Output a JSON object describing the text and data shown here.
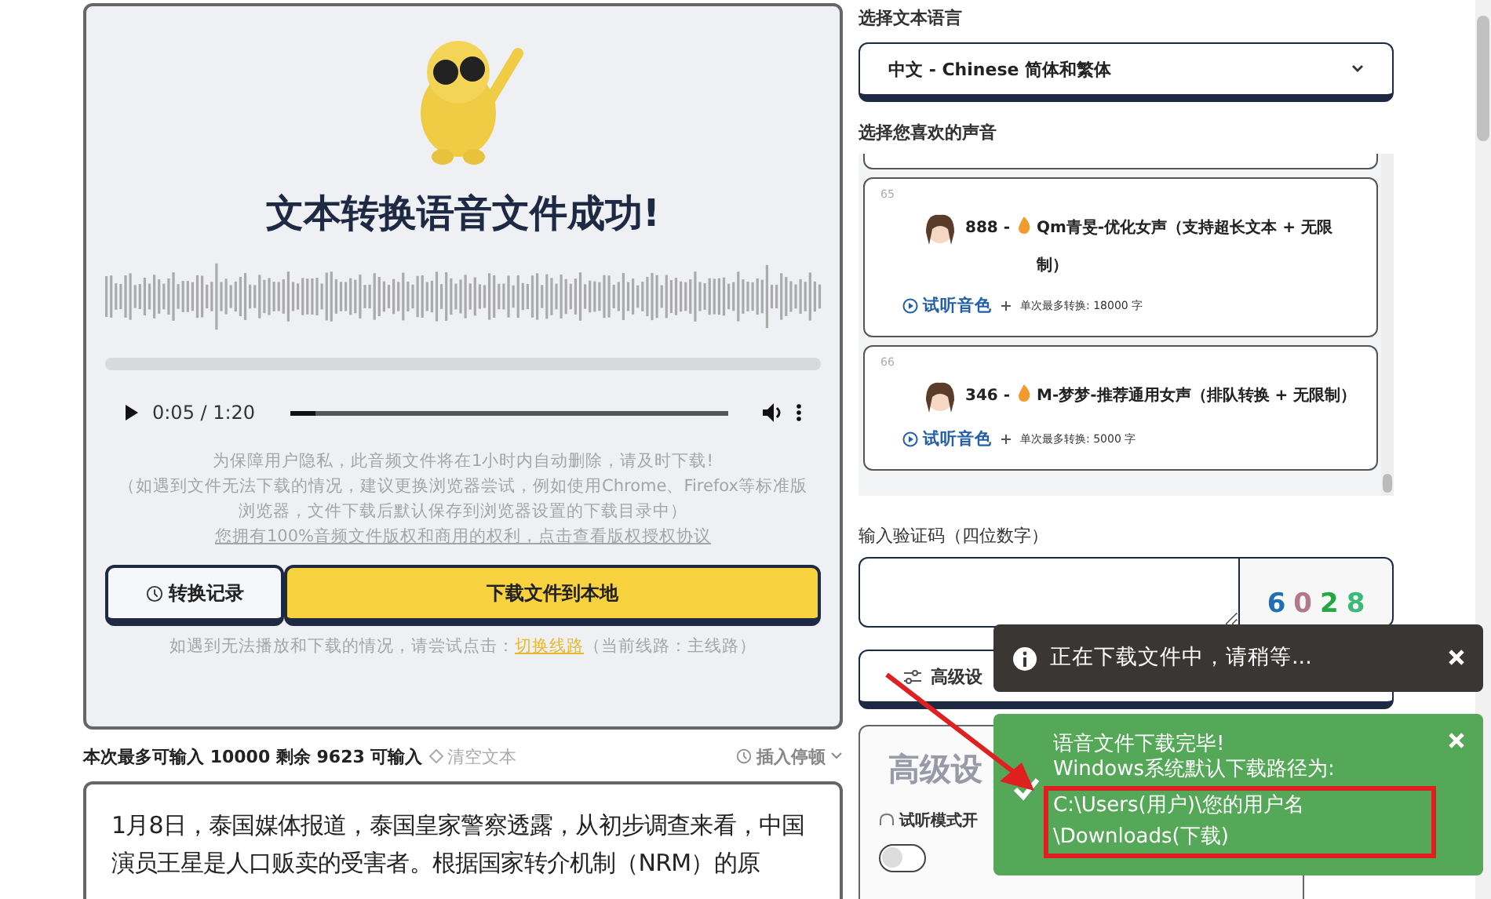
{
  "result_panel": {
    "title": "文本转换语音文件成功!",
    "player": {
      "time": "0:05 / 1:20",
      "level": 0.06
    },
    "notices": [
      "为保障用户隐私，此音频文件将在1小时内自动删除，请及时下载!",
      "（如遇到文件无法下载的情况，建议更换浏览器尝试，例如使用Chrome、Firefox等标准版浏览器，文件下载后默认保存到浏览器设置的下载目录中）"
    ],
    "license_link": "您拥有100%音频文件版权和商用的权利，点击查看版权授权协议",
    "buttons": [
      {
        "kind": "history",
        "label": "转换记录"
      },
      {
        "kind": "download",
        "label": "下载文件到本地"
      }
    ],
    "route_note": {
      "before": "如遇到无法播放和下载的情况，请尝试点击：",
      "link": "切换线路",
      "after": "（当前线路：主线路）"
    }
  },
  "text_input": {
    "limit_note": "本次最多可输入 10000 剩余 9623 可输入",
    "clear": "清空文本",
    "pause": "插入停顿",
    "value": "1月8日，泰国媒体报道，泰国皇家警察透露，从初步调查来看，中国演员王星是人口贩卖的受害者。根据国家转介机制（NRM）的原"
  },
  "language": {
    "label": "选择文本语言",
    "value": "中文 - Chinese 简体和繁体"
  },
  "voices": {
    "label": "选择您喜欢的声音",
    "items": [
      {
        "index": "65",
        "number": "888 -",
        "name": "Qm青旻-优化女声（支持超长文本 + 无限制）",
        "preview": "试听音色",
        "limit": "单次最多转换: 18000 字"
      },
      {
        "index": "66",
        "number": "346 -",
        "name": "M-梦梦-推荐通用女声（排队转换 + 无限制）",
        "preview": "试听音色",
        "limit": "单次最多转换: 5000 字"
      }
    ]
  },
  "captcha": {
    "label": "输入验证码（四位数字）",
    "chars": [
      {
        "text": "6",
        "color": "#1f6fb5"
      },
      {
        "text": "0",
        "color": "#b07a8a"
      },
      {
        "text": "2",
        "color": "#22a845"
      },
      {
        "text": "8",
        "color": "#3cb878"
      }
    ]
  },
  "advanced": {
    "button": "高级设",
    "heading": "高级设",
    "preview_mode": "试听模式开",
    "toggle_on": false
  },
  "toasts": [
    {
      "kind": "info",
      "message": "正在下载文件中，请稍等..."
    },
    {
      "kind": "success",
      "lines": [
        "语音文件下载完毕!",
        "Windows系统默认下载路径为:"
      ],
      "path": "C:\\Users(用户)\\您的用户名\\Downloads(下载)"
    }
  ]
}
